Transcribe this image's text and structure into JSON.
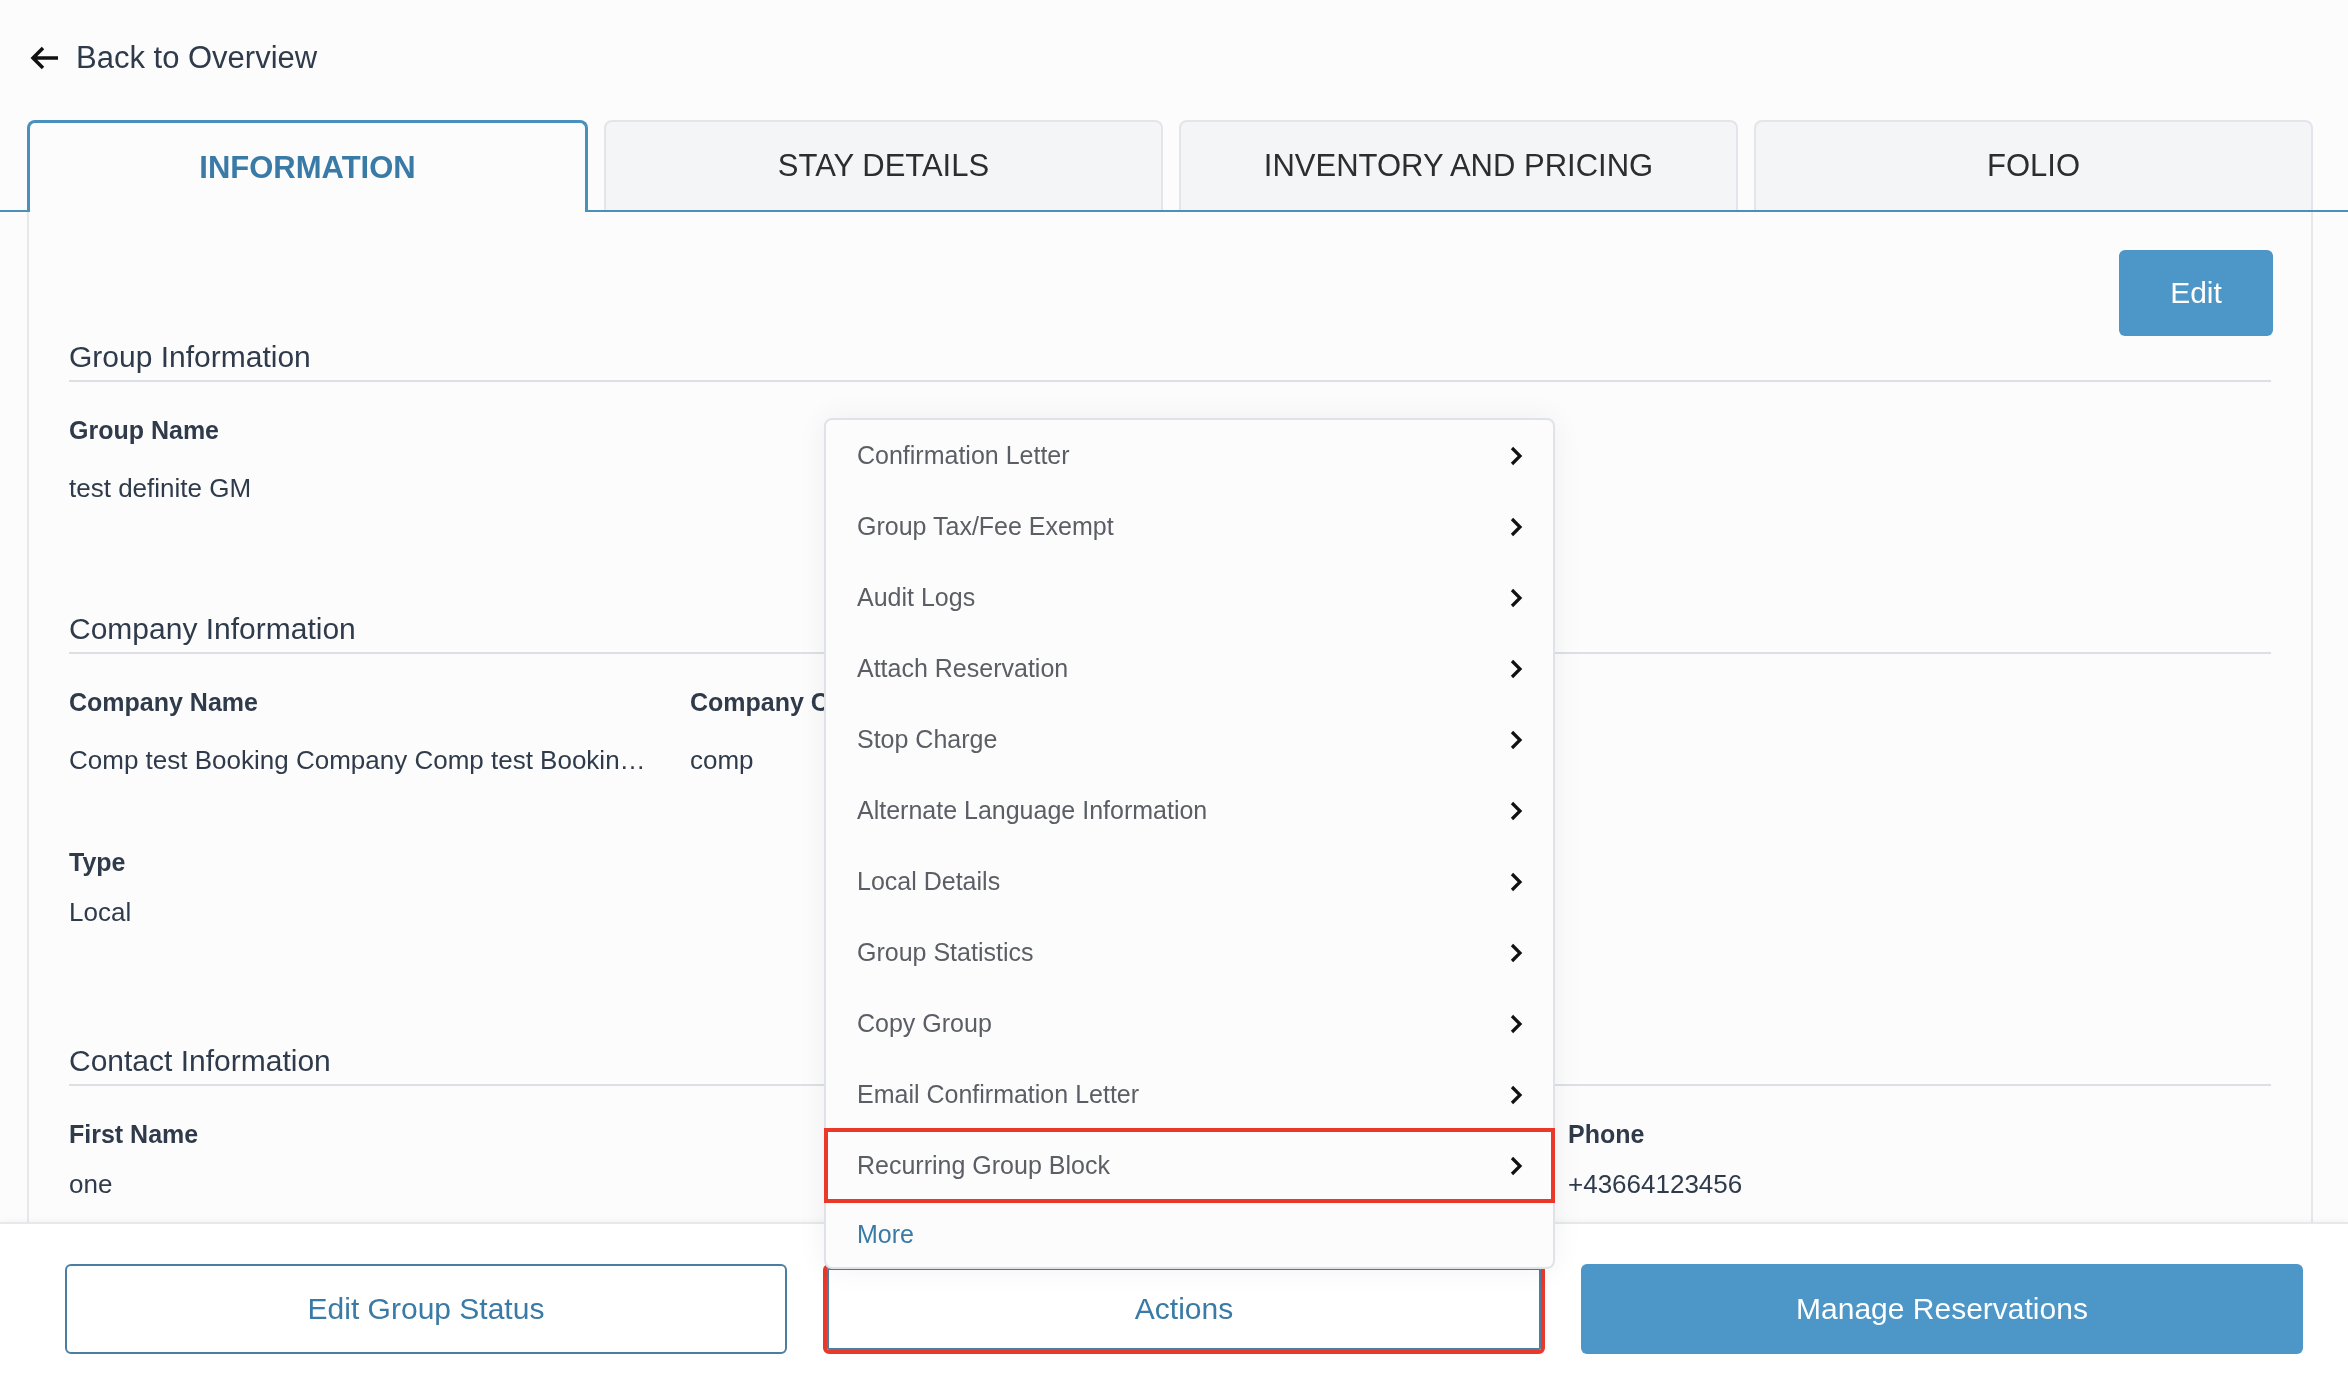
{
  "back_link": {
    "label": "Back to Overview"
  },
  "tabs": [
    {
      "label": "INFORMATION",
      "selected": true
    },
    {
      "label": "STAY DETAILS",
      "selected": false
    },
    {
      "label": "INVENTORY AND PRICING",
      "selected": false
    },
    {
      "label": "FOLIO",
      "selected": false
    }
  ],
  "edit_button": "Edit",
  "sections": [
    {
      "title": "Group Information",
      "fields": [
        {
          "label": "Group Name",
          "value": "test definite GM"
        }
      ]
    },
    {
      "title": "Company Information",
      "fields": [
        {
          "label": "Company Name",
          "value": "Comp test Booking Company Comp test Bookin…"
        },
        {
          "label": "Company C",
          "value": "comp"
        },
        {
          "label": "Type",
          "value": "Local"
        }
      ]
    },
    {
      "title": "Contact Information",
      "fields": [
        {
          "label": "First Name",
          "value": "one"
        },
        {
          "label": "Phone",
          "value": "+43664123456"
        }
      ]
    }
  ],
  "actions_menu": {
    "items": [
      {
        "label": "Confirmation Letter",
        "highlighted": false
      },
      {
        "label": "Group Tax/Fee Exempt",
        "highlighted": false
      },
      {
        "label": "Audit Logs",
        "highlighted": false
      },
      {
        "label": "Attach Reservation",
        "highlighted": false
      },
      {
        "label": "Stop Charge",
        "highlighted": false
      },
      {
        "label": "Alternate Language Information",
        "highlighted": false
      },
      {
        "label": "Local Details",
        "highlighted": false
      },
      {
        "label": "Group Statistics",
        "highlighted": false
      },
      {
        "label": "Copy Group",
        "highlighted": false
      },
      {
        "label": "Email Confirmation Letter",
        "highlighted": false
      },
      {
        "label": "Recurring Group Block",
        "highlighted": true
      }
    ],
    "more": "More"
  },
  "footer_buttons": [
    {
      "label": "Edit Group Status",
      "kind": "outline",
      "highlighted": false
    },
    {
      "label": "Actions",
      "kind": "outline",
      "highlighted": true
    },
    {
      "label": "Manage Reservations",
      "kind": "primary",
      "highlighted": false
    }
  ]
}
